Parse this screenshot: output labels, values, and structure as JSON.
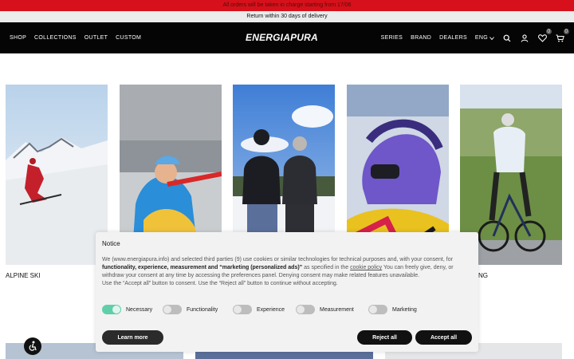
{
  "promo": {
    "line1": "All orders will be taken in charge starting from 17/06",
    "line2": "Return within 30 days of delivery"
  },
  "header": {
    "nav_left": [
      "SHOP",
      "COLLECTIONS",
      "OUTLET",
      "CUSTOM"
    ],
    "logo": "ENERGIAPURA",
    "nav_right": [
      "SERIES",
      "BRAND",
      "DEALERS"
    ],
    "language": "ENG",
    "icons": [
      "search-icon",
      "user-icon",
      "heart-icon",
      "cart-icon"
    ],
    "wishlist_count": "0",
    "cart_count": "0",
    "background": "#050505"
  },
  "categories": [
    {
      "label": "ALPINE SKI"
    },
    {
      "label": ""
    },
    {
      "label": ""
    },
    {
      "label": ""
    },
    {
      "label": "NG"
    }
  ],
  "cookie": {
    "title": "Notice",
    "text_a": "We (www.energiapura.info) and selected third parties (9) use cookies or similar technologies for technical purposes and, with your consent, for ",
    "text_bold": "functionality, experience, measurement and “marketing (personalized ads)”",
    "text_b": " as specified in the ",
    "link": "cookie policy",
    "text_c": " You can freely give, deny, or withdraw your consent at any time by accessing the preferences panel. Denying consent may make related features unavailable.",
    "text_d": "Use the “Accept all” button to consent. Use the “Reject all” button to continue without accepting.",
    "toggles": [
      {
        "label": "Necessary",
        "on": true
      },
      {
        "label": "Functionality",
        "on": false
      },
      {
        "label": "Experience",
        "on": false
      },
      {
        "label": "Measurement",
        "on": false
      },
      {
        "label": "Marketing",
        "on": false
      }
    ],
    "learn_more": "Learn more",
    "reject_all": "Reject all",
    "accept_all": "Accept all",
    "accent": "#5fcfa9"
  },
  "colors": {
    "promo_red": "#d6111b",
    "promo_grey": "#ececec"
  }
}
